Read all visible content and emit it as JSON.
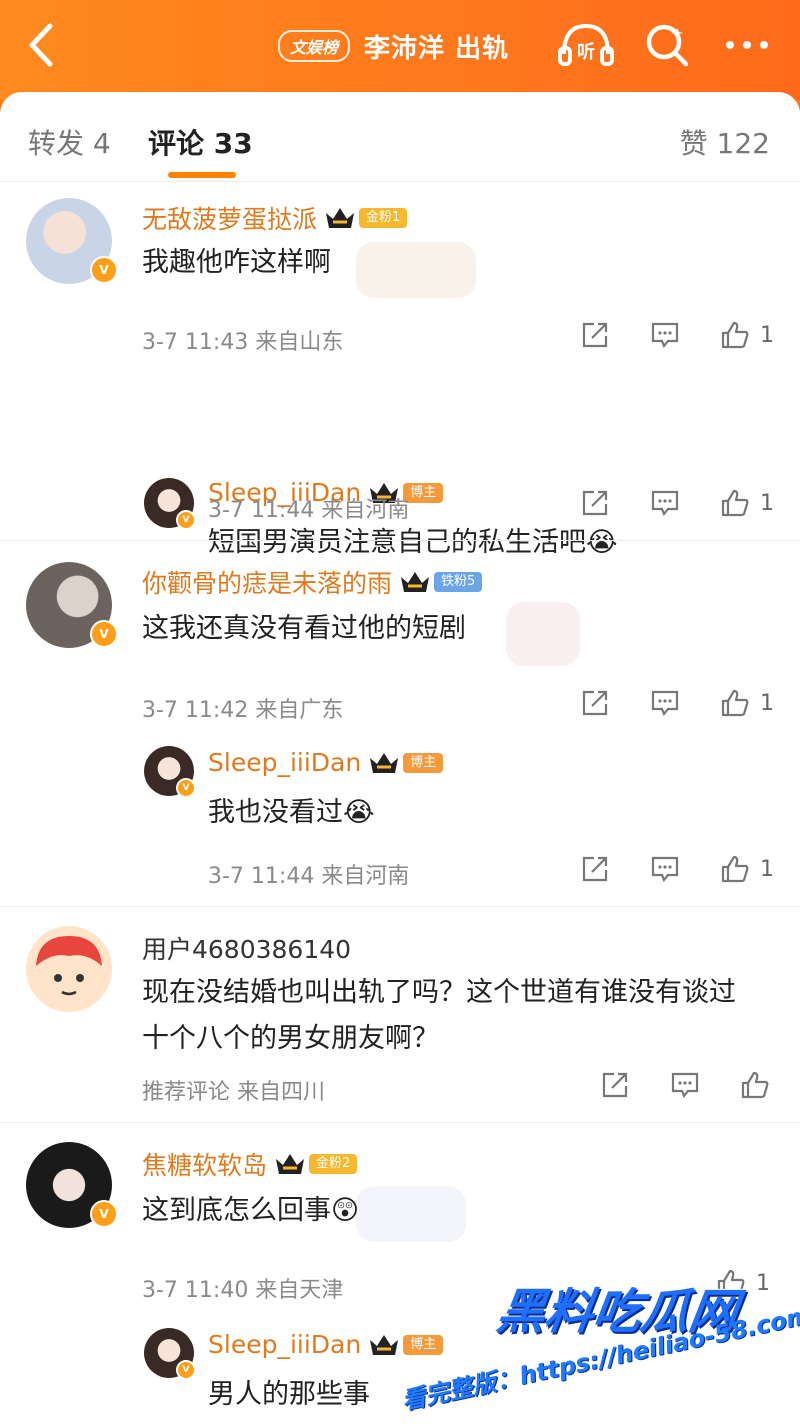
{
  "header": {
    "topic_tag": "文娱榜",
    "topic_title": "李沛洋 出轨",
    "listen_label": "听"
  },
  "tabs": {
    "repost": "转发 4",
    "comment": "评论 33",
    "like": "赞 122"
  },
  "comments": [
    {
      "user": "无敌菠萝蛋挞派",
      "badge": "金粉1",
      "text": "我趣他咋这样啊",
      "meta": "3-7 11:43  来自山东",
      "likes": "1",
      "reply": {
        "user": "Sleep_iiiDan",
        "badge": "博主",
        "text": "短国男演员注意自己的私生活吧😭",
        "meta": "3-7 11:44  来自河南",
        "likes": "1"
      }
    },
    {
      "user": "你颧骨的痣是未落的雨",
      "badge": "铁粉5",
      "text": "这我还真没有看过他的短剧",
      "meta": "3-7 11:42  来自广东",
      "likes": "1",
      "reply": {
        "user": "Sleep_iiiDan",
        "badge": "博主",
        "text": "我也没看过😭",
        "meta": "3-7 11:44  来自河南",
        "likes": "1"
      }
    },
    {
      "user": "用户4680386140",
      "badge": "",
      "text": "现在没结婚也叫出轨了吗？这个世道有谁没有谈过十个八个的男女朋友啊？",
      "meta": "推荐评论  来自四川",
      "likes": ""
    },
    {
      "user": "焦糖软软岛",
      "badge": "金粉2",
      "text": "这到底怎么回事😲",
      "meta": "3-7 11:40  来自天津",
      "likes": "1",
      "reply": {
        "user": "Sleep_iiiDan",
        "badge": "博主",
        "text": "男人的那些事"
      }
    }
  ],
  "watermark": {
    "brand": "黑料吃瓜网",
    "line": "看完整版：https://heiliao-58.com"
  },
  "colors": {
    "header_orange": "#ff7a1c",
    "username_orange": "#e07a1f",
    "tab_underline": "#ff8200",
    "meta_gray": "#8a8a8a"
  }
}
